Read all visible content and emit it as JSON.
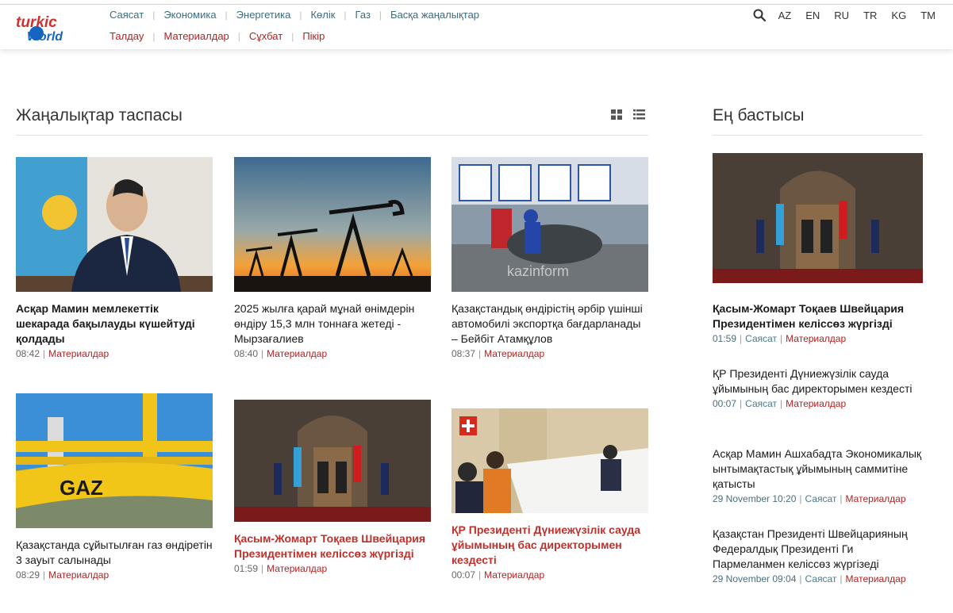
{
  "header": {
    "logo_text_top": "turkic",
    "logo_text_bottom": "World",
    "nav_row1": [
      "Саясат",
      "Экономика",
      "Энергетика",
      "Көлік",
      "Газ",
      "Басқа жаңалықтар"
    ],
    "nav_row2": [
      "Талдау",
      "Материалдар",
      "Сұхбат",
      "Пікір"
    ],
    "languages": [
      "AZ",
      "EN",
      "RU",
      "TR",
      "KG",
      "TM"
    ]
  },
  "feed": {
    "title": "Жаңалықтар таспасы",
    "cards": [
      {
        "title": "Асқар Мамин мемлекеттік шекарада бақылауды күшейтуді қолдады",
        "time": "08:42",
        "category": "Материалдар"
      },
      {
        "title": "2025 жылға қарай мұнай өнімдерін өндіру 15,3 млн тоннаға жетеді - Мырзағалиев",
        "time": "08:40",
        "category": "Материалдар"
      },
      {
        "title": "Қазақстандық өндірістің әрбір үшінші автомобилі экспортқа бағдарланады – Бейбіт Атамқұлов",
        "time": "08:37",
        "category": "Материалдар",
        "watermark": "kazinform"
      },
      {
        "title": "Қазақстанда сұйытылған газ өндіретін 3 зауыт салынады",
        "time": "08:29",
        "category": "Материалдар",
        "pipe_text": "GAZ"
      },
      {
        "title": "Қасым-Жомарт Тоқаев Швейцария Президентімен келіссөз жүргізді",
        "time": "01:59",
        "category": "Материалдар"
      },
      {
        "title": "ҚР Президенті Дүниежүзілік сауда ұйымының бас директорымен кездесті",
        "time": "00:07",
        "category": "Материалдар"
      }
    ]
  },
  "sidebar": {
    "title": "Ең бастысы",
    "items": [
      {
        "title": "Қасым-Жомарт Тоқаев Швейцария Президентімен келіссөз жүргізді",
        "time": "01:59",
        "cat1": "Саясат",
        "cat2": "Материалдар"
      },
      {
        "title": "ҚР Президенті Дүниежүзілік сауда ұйымының бас директорымен кездесті",
        "time": "00:07",
        "cat1": "Саясат",
        "cat2": "Материалдар"
      },
      {
        "title": "Асқар Мамин Ашхабадта Экономикалық ынтымақтастық ұйымының саммитіне қатысты",
        "time": "29 November 10:20",
        "cat1": "Саясат",
        "cat2": "Материалдар"
      },
      {
        "title": "Қазақстан Президенті Швейцарияның Федералдық Президенті Ги Пармеланмен келіссөз жүргізеді",
        "time": "29 November 09:04",
        "cat1": "Саясат",
        "cat2": "Материалдар"
      }
    ]
  },
  "colors": {
    "nav_row1": "#3f6b7c",
    "nav_row2": "#b22222",
    "category": "#b22222",
    "red_title": "#c0302a"
  }
}
